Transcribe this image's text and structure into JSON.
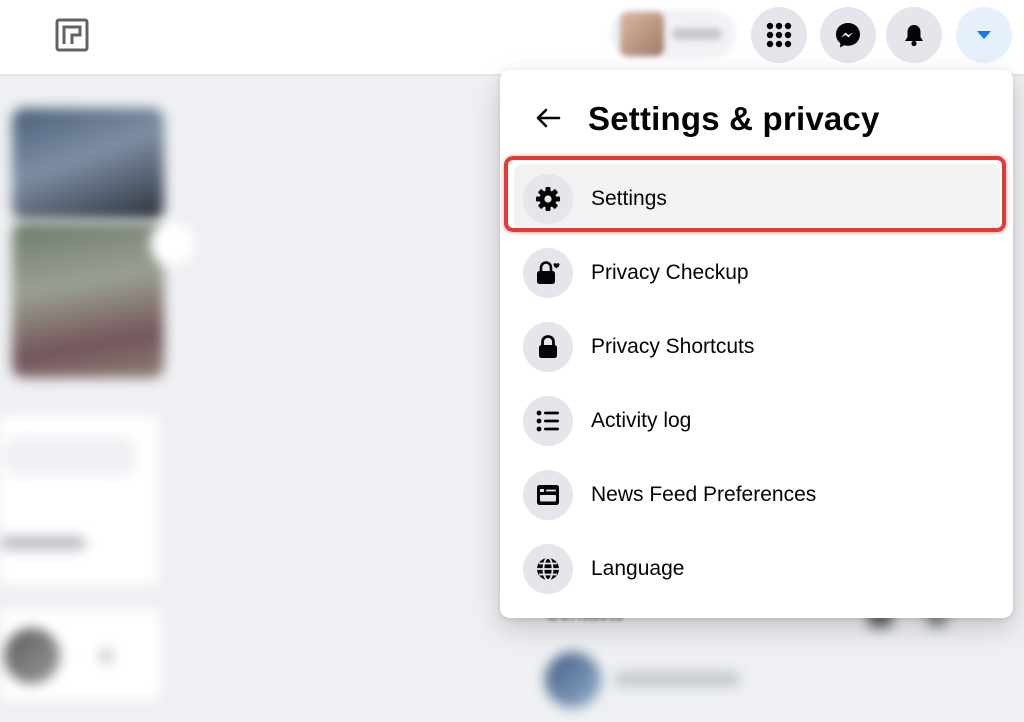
{
  "topbar": {
    "buttons": {
      "menu_icon": "grid-menu-icon",
      "messenger_icon": "messenger-icon",
      "notifications_icon": "bell-icon",
      "account_icon": "caret-down-icon"
    },
    "accent_color": "#1877f2"
  },
  "background": {
    "contacts_title": "Contacts"
  },
  "dropdown": {
    "title": "Settings & privacy",
    "back_icon": "arrow-left-icon",
    "items": [
      {
        "label": "Settings",
        "icon": "gear-icon",
        "highlighted": true
      },
      {
        "label": "Privacy Checkup",
        "icon": "lock-heart-icon"
      },
      {
        "label": "Privacy Shortcuts",
        "icon": "lock-icon"
      },
      {
        "label": "Activity log",
        "icon": "list-icon"
      },
      {
        "label": "News Feed Preferences",
        "icon": "news-feed-icon"
      },
      {
        "label": "Language",
        "icon": "globe-icon"
      }
    ],
    "highlight_color": "#e53935"
  }
}
